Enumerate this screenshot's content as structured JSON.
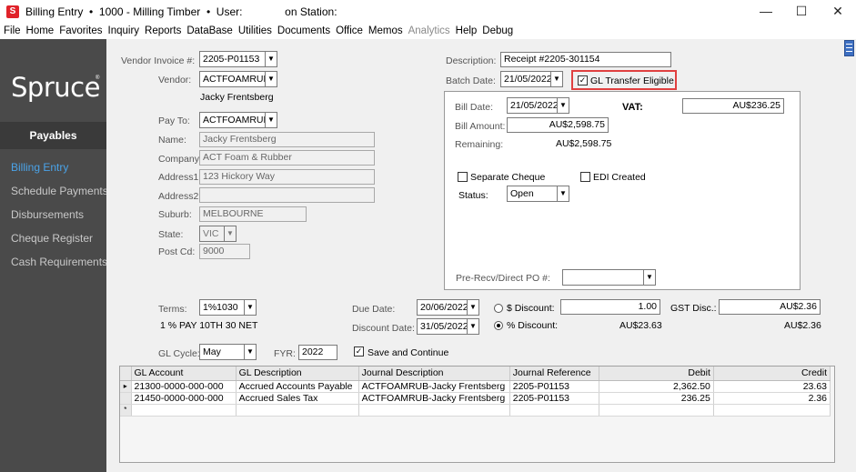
{
  "window": {
    "icon_letter": "S",
    "title": "Billing Entry  •  1000 - Milling Timber  •  User:              on Station:",
    "minimize": "—",
    "maximize": "☐",
    "close": "✕"
  },
  "menu": [
    "File",
    "Home",
    "Favorites",
    "Inquiry",
    "Reports",
    "DataBase",
    "Utilities",
    "Documents",
    "Office",
    "Memos",
    "Analytics",
    "Help",
    "Debug"
  ],
  "menu_disabled": "Analytics",
  "sidebar": {
    "logo": "Spruce",
    "logo_mark": "®",
    "module": "Payables",
    "links": [
      "Billing Entry",
      "Schedule Payments",
      "Disbursements",
      "Cheque Register",
      "Cash Requirements"
    ],
    "active_link": "Billing Entry"
  },
  "vendor": {
    "invoice_label": "Vendor Invoice #:",
    "invoice_value": "2205-P01153",
    "vendor_label": "Vendor:",
    "vendor_value": "ACTFOAMRUB",
    "vendor_name": "Jacky Frentsberg",
    "payto_label": "Pay To:",
    "payto_value": "ACTFOAMRUB",
    "name_label": "Name:",
    "name_value": "Jacky Frentsberg",
    "company_label": "Company:",
    "company_value": "ACT Foam & Rubber",
    "address1_label": "Address1:",
    "address1_value": "123 Hickory Way",
    "address2_label": "Address2:",
    "address2_value": "",
    "suburb_label": "Suburb:",
    "suburb_value": "MELBOURNE",
    "state_label": "State:",
    "state_value": "VIC",
    "postcd_label": "Post Cd:",
    "postcd_value": "9000"
  },
  "header": {
    "description_label": "Description:",
    "description_value": "Receipt #2205-301154",
    "batch_date_label": "Batch Date:",
    "batch_date_value": "21/05/2022",
    "gl_transfer_label": "GL Transfer Eligible",
    "gl_transfer_checked": "✓"
  },
  "bill": {
    "bill_date_label": "Bill Date:",
    "bill_date_value": "21/05/2022",
    "vat_label": "VAT:",
    "vat_value": "AU$236.25",
    "bill_amount_label": "Bill Amount:",
    "bill_amount_value": "AU$2,598.75",
    "remaining_label": "Remaining:",
    "remaining_value": "AU$2,598.75",
    "separate_cheque_label": "Separate Cheque",
    "edi_created_label": "EDI Created",
    "status_label": "Status:",
    "status_value": "Open",
    "pre_recv_label": "Pre-Recv/Direct PO #:",
    "pre_recv_value": ""
  },
  "terms": {
    "terms_label": "Terms:",
    "terms_value": "1%1030",
    "terms_desc": "1 % PAY 10TH 30 NET",
    "due_date_label": "Due Date:",
    "due_date_value": "20/06/2022",
    "discount_date_label": "Discount Date:",
    "discount_date_value": "31/05/2022",
    "dollar_discount_label": "$ Discount:",
    "dollar_discount_value": "1.00",
    "pct_discount_label": "% Discount:",
    "pct_discount_value": "AU$23.63",
    "gst_disc_label": "GST Disc.:",
    "gst_disc_value": "AU$2.36",
    "gst_disc_value2": "AU$2.36",
    "gl_cycle_label": "GL Cycle:",
    "gl_cycle_value": "May",
    "fyr_label": "FYR:",
    "fyr_value": "2022",
    "save_continue_label": "Save and Continue",
    "save_continue_checked": "✓"
  },
  "grid": {
    "columns": [
      "GL Account",
      "GL Description",
      "Journal Description",
      "Journal Reference",
      "Debit",
      "Credit"
    ],
    "rows": [
      [
        "21300-0000-000-000",
        "Accrued Accounts Payable",
        "ACTFOAMRUB-Jacky Frentsberg",
        "2205-P01153",
        "2,362.50",
        "23.63"
      ],
      [
        "21450-0000-000-000",
        "Accrued Sales Tax",
        "ACTFOAMRUB-Jacky Frentsberg",
        "2205-P01153",
        "236.25",
        "2.36"
      ]
    ],
    "current_row_marker": "▸",
    "new_row_marker": "*"
  },
  "colors": {
    "sidebar_bg": "#4a4a4a",
    "active_link": "#4aa3e8",
    "highlight": "#e04040"
  },
  "icons": {
    "app": "spruce-s-icon",
    "dropdown": "chevron-down-icon",
    "menu_toggle": "hamburger-icon"
  }
}
